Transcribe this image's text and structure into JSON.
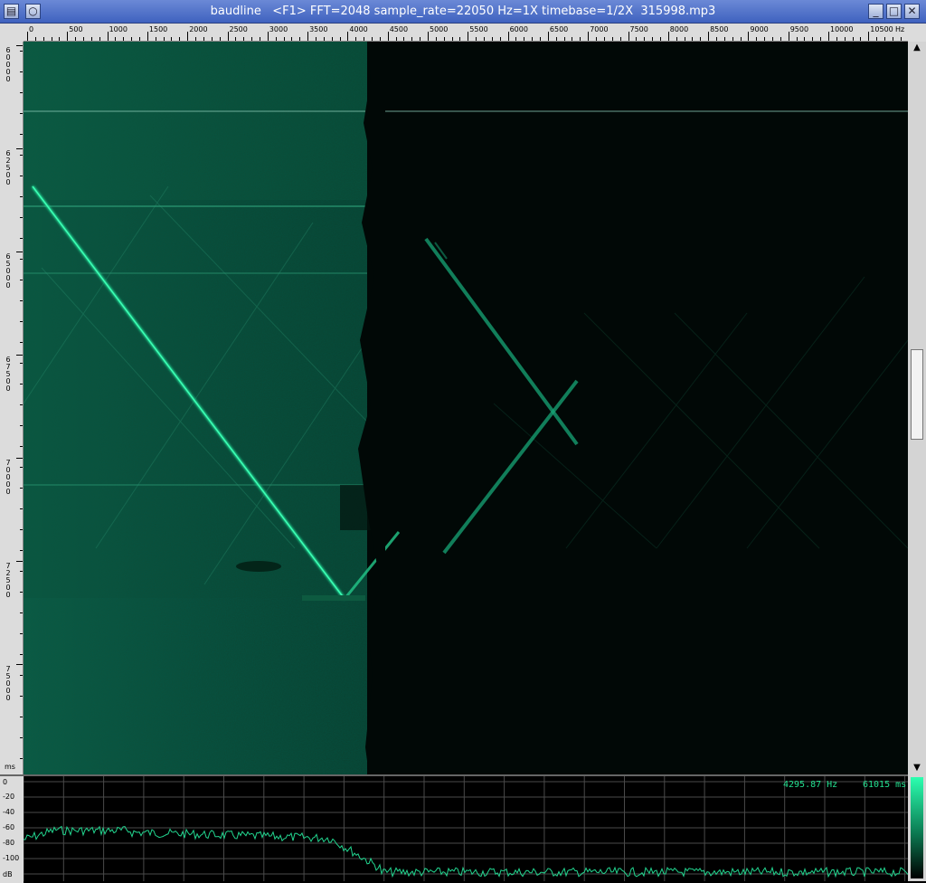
{
  "window": {
    "title": "baudline   <F1> FFT=2048 sample_rate=22050 Hz=1X timebase=1/2X  315998.mp3"
  },
  "freq_axis": {
    "labels": [
      "0",
      "500",
      "1000",
      "1500",
      "2000",
      "2500",
      "3000",
      "3500",
      "4000",
      "4500",
      "5000",
      "5500",
      "6000",
      "6500",
      "7000",
      "7500",
      "8000",
      "8500",
      "9000",
      "9500",
      "10000",
      "10500"
    ],
    "unit": "Hz"
  },
  "time_axis": {
    "labels": [
      "60000",
      "62500",
      "65000",
      "67500",
      "70000",
      "72500",
      "75000"
    ],
    "unit": "ms"
  },
  "db_axis": {
    "labels": [
      "0",
      "-20",
      "-40",
      "-60",
      "-80",
      "-100"
    ],
    "unit": "dB"
  },
  "readout": {
    "frequency": "4295.87 Hz",
    "time": "61015 ms"
  },
  "colors": {
    "spectro_bright": "#18c88a",
    "spectro_dim": "#0d4a36",
    "grid": "#555555",
    "trace": "#22d58f"
  }
}
